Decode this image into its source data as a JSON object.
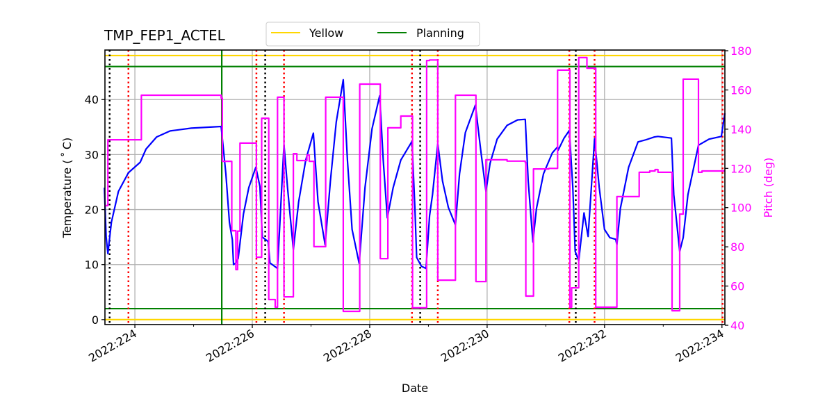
{
  "chart_data": {
    "type": "line",
    "title": "TMP_FEP1_ACTEL",
    "xlabel": "Date",
    "ylabel": "Temperature ($^\\circ$C)",
    "ylabel_display": "Temperature ( ˚ C)",
    "y2label": "Pitch (deg)",
    "xlim": [
      223.49,
      234.05
    ],
    "ylim": [
      -0.9,
      49
    ],
    "y2lim": [
      40,
      180
    ],
    "grid": true,
    "x_ticks": [
      {
        "value": 224,
        "label": "2022:224"
      },
      {
        "value": 226,
        "label": "2022:226"
      },
      {
        "value": 228,
        "label": "2022:228"
      },
      {
        "value": 230,
        "label": "2022:230"
      },
      {
        "value": 232,
        "label": "2022:232"
      },
      {
        "value": 234,
        "label": "2022:234"
      }
    ],
    "x_minor_ticks": [
      225,
      227,
      229,
      231,
      233
    ],
    "y_ticks": [
      {
        "value": 0,
        "label": "0"
      },
      {
        "value": 10,
        "label": "10"
      },
      {
        "value": 20,
        "label": "20"
      },
      {
        "value": 30,
        "label": "30"
      },
      {
        "value": 40,
        "label": "40"
      }
    ],
    "y2_ticks": [
      {
        "value": 40,
        "label": "40"
      },
      {
        "value": 60,
        "label": "60"
      },
      {
        "value": 80,
        "label": "80"
      },
      {
        "value": 100,
        "label": "100"
      },
      {
        "value": 120,
        "label": "120"
      },
      {
        "value": 140,
        "label": "140"
      },
      {
        "value": 160,
        "label": "160"
      },
      {
        "value": 180,
        "label": "180"
      }
    ],
    "legend": {
      "placement": "top-center",
      "entries": [
        {
          "name": "Yellow",
          "color": "#ffd700"
        },
        {
          "name": "Planning",
          "color": "#008000"
        }
      ]
    },
    "limit_lines": [
      {
        "name": "Yellow",
        "value": 48,
        "color": "#ffd700"
      },
      {
        "name": "Yellow",
        "value": 0,
        "color": "#ffd700"
      },
      {
        "name": "Planning",
        "value": 46,
        "color": "#008000"
      },
      {
        "name": "Planning",
        "value": 2,
        "color": "#008000"
      }
    ],
    "vertical_lines": {
      "green_solid": [
        225.48
      ],
      "black_dotted": [
        223.57,
        226.22,
        228.86,
        231.51
      ],
      "red_dotted": [
        223.89,
        226.07,
        226.54,
        228.72,
        229.16,
        231.4,
        231.83,
        234.01
      ]
    },
    "series": [
      {
        "name": "Temperature",
        "axis": "left",
        "color": "#0000ff",
        "x": [
          223.48,
          223.51,
          223.54,
          223.6,
          223.72,
          223.89,
          224.09,
          224.19,
          224.37,
          224.6,
          224.96,
          225.47,
          225.55,
          225.61,
          225.66,
          225.68,
          225.72,
          225.76,
          225.85,
          225.94,
          226.06,
          226.13,
          226.17,
          226.27,
          226.3,
          226.43,
          226.54,
          226.6,
          226.7,
          226.79,
          226.91,
          227.04,
          227.12,
          227.24,
          227.33,
          227.43,
          227.55,
          227.62,
          227.7,
          227.82,
          227.92,
          228.04,
          228.17,
          228.23,
          228.3,
          228.4,
          228.53,
          228.72,
          228.77,
          228.8,
          228.88,
          228.96,
          229.02,
          229.07,
          229.16,
          229.24,
          229.34,
          229.46,
          229.53,
          229.63,
          229.8,
          229.89,
          229.98,
          230.05,
          230.17,
          230.34,
          230.52,
          230.65,
          230.7,
          230.78,
          230.84,
          230.96,
          231.11,
          231.2,
          231.21,
          231.31,
          231.4,
          231.46,
          231.5,
          231.56,
          231.65,
          231.72,
          231.83,
          231.91,
          232.0,
          232.09,
          232.19,
          232.21,
          232.27,
          232.41,
          232.57,
          232.71,
          232.85,
          232.91,
          233.14,
          233.18,
          233.28,
          233.34,
          233.42,
          233.6,
          233.78,
          233.99,
          234.05
        ],
        "values": [
          24.0,
          15.1,
          12.0,
          17.7,
          23.3,
          26.7,
          28.6,
          31.0,
          33.2,
          34.3,
          34.8,
          35.1,
          26.5,
          17.7,
          14.5,
          10.0,
          10.3,
          11.1,
          19.2,
          24.0,
          27.7,
          24.2,
          15.0,
          14.2,
          10.3,
          9.3,
          31.8,
          24.0,
          12.7,
          21.4,
          29.0,
          33.9,
          21.4,
          13.6,
          25.2,
          35.9,
          43.6,
          29.0,
          16.4,
          10.2,
          24.0,
          34.7,
          40.7,
          29.0,
          18.5,
          24.0,
          29.0,
          32.4,
          20.2,
          11.3,
          9.7,
          9.3,
          18.9,
          22.7,
          32.0,
          25.2,
          20.4,
          17.2,
          26.5,
          34.0,
          39.0,
          30.9,
          23.3,
          28.4,
          32.8,
          35.3,
          36.3,
          36.4,
          25.2,
          14.1,
          20.2,
          26.5,
          30.3,
          31.4,
          30.8,
          33.0,
          34.4,
          24.0,
          12.4,
          10.7,
          19.4,
          15.1,
          32.9,
          24.0,
          16.4,
          14.9,
          14.6,
          13.6,
          20.2,
          27.7,
          32.3,
          32.7,
          33.2,
          33.3,
          33.0,
          22.7,
          12.4,
          14.9,
          22.7,
          31.7,
          32.8,
          33.3,
          37.5
        ]
      },
      {
        "name": "Pitch",
        "axis": "right",
        "color": "#ff00ff",
        "step": true,
        "x": [
          223.48,
          223.54,
          224.11,
          225.47,
          225.49,
          225.65,
          225.72,
          225.75,
          225.79,
          226.07,
          226.16,
          226.28,
          226.39,
          226.43,
          226.54,
          226.7,
          226.76,
          226.93,
          226.97,
          227.05,
          227.25,
          227.55,
          227.83,
          228.18,
          228.31,
          228.53,
          228.73,
          228.97,
          229.02,
          229.16,
          229.46,
          229.81,
          229.98,
          230.34,
          230.65,
          230.66,
          230.79,
          231.05,
          231.2,
          231.41,
          231.44,
          231.56,
          231.7,
          231.85,
          232.21,
          232.59,
          232.77,
          232.86,
          232.91,
          233.15,
          233.28,
          233.34,
          233.6,
          233.66,
          234.05
        ],
        "values": [
          101.0,
          134.6,
          157.3,
          155.9,
          123.6,
          88.2,
          68.4,
          88.0,
          132.9,
          74.7,
          145.6,
          53.1,
          49.2,
          156.3,
          54.5,
          127.5,
          124.0,
          126.8,
          123.6,
          80.1,
          156.3,
          47.1,
          163.0,
          74.0,
          140.7,
          146.7,
          48.9,
          175.0,
          175.3,
          63.0,
          157.3,
          62.3,
          124.4,
          123.7,
          122.9,
          54.9,
          119.7,
          120.0,
          170.1,
          49.2,
          59.1,
          176.5,
          171.1,
          49.2,
          105.6,
          118.0,
          118.7,
          119.4,
          118.0,
          47.4,
          96.7,
          165.5,
          118.0,
          118.7,
          118.7
        ]
      }
    ]
  }
}
